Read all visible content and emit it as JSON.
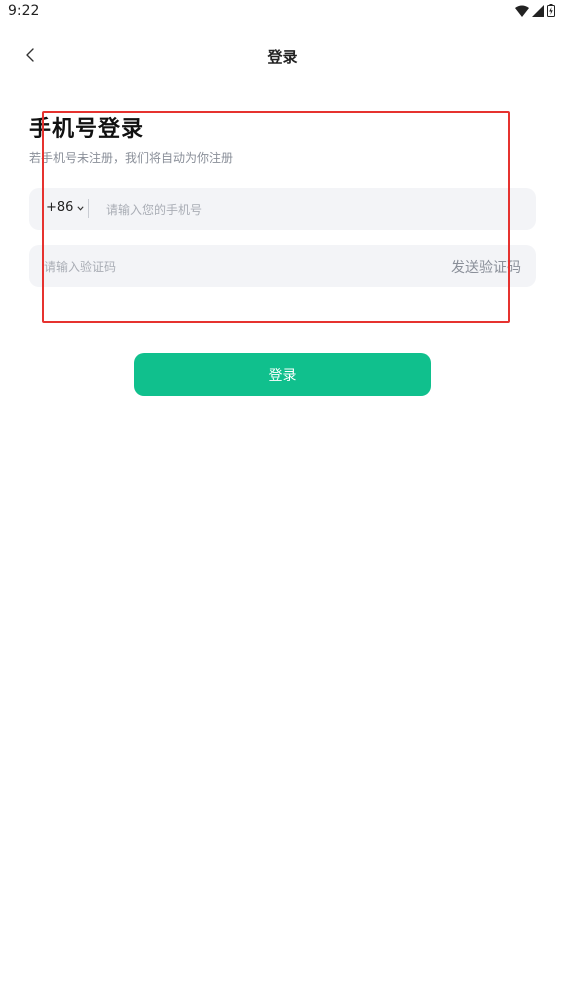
{
  "status_bar": {
    "time": "9:22",
    "icons": [
      "wifi-icon",
      "signal-icon",
      "battery-icon"
    ]
  },
  "nav": {
    "back_icon": "chevron-left-icon",
    "title": "登录"
  },
  "heading": {
    "title": "手机号登录",
    "subtitle": "若手机号未注册，我们将自动为你注册"
  },
  "phone_field": {
    "country_code": "+86",
    "dropdown_icon": "chevron-down-icon",
    "placeholder": "请输入您的手机号",
    "value": ""
  },
  "code_field": {
    "placeholder": "请输入验证码",
    "value": "",
    "send_label": "发送验证码"
  },
  "login_button": {
    "label": "登录"
  },
  "colors": {
    "accent": "#10c08d",
    "field_bg": "#f3f4f7",
    "highlight": "#e6322f",
    "muted_text": "#8a8f99"
  }
}
